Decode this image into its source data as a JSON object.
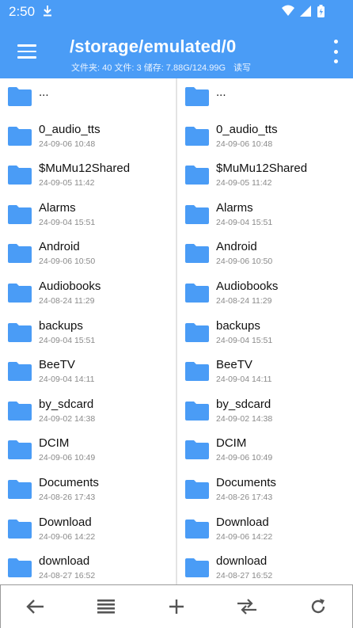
{
  "status_bar": {
    "time": "2:50",
    "icons": [
      "download-icon",
      "wifi-icon",
      "signal-icon",
      "battery-charging-icon"
    ]
  },
  "app_bar": {
    "path": "/storage/emulated/0",
    "info": "文件夹: 40 文件: 3 储存: 7.88G/124.99G",
    "access": "读写",
    "color": "#4a9cf6"
  },
  "up_entry": {
    "name": "..."
  },
  "files": [
    {
      "name": "0_audio_tts",
      "date": "24-09-06 10:48"
    },
    {
      "name": "$MuMu12Shared",
      "date": "24-09-05 11:42"
    },
    {
      "name": "Alarms",
      "date": "24-09-04 15:51"
    },
    {
      "name": "Android",
      "date": "24-09-06 10:50"
    },
    {
      "name": "Audiobooks",
      "date": "24-08-24 11:29"
    },
    {
      "name": "backups",
      "date": "24-09-04 15:51"
    },
    {
      "name": "BeeTV",
      "date": "24-09-04 14:11"
    },
    {
      "name": "by_sdcard",
      "date": "24-09-02 14:38"
    },
    {
      "name": "DCIM",
      "date": "24-09-06 10:49"
    },
    {
      "name": "Documents",
      "date": "24-08-26 17:43"
    },
    {
      "name": "Download",
      "date": "24-09-06 14:22"
    },
    {
      "name": "download",
      "date": "24-08-27 16:52"
    }
  ],
  "toolbar": [
    "back-arrow-icon",
    "list-view-icon",
    "add-icon",
    "swap-panes-icon",
    "refresh-icon"
  ]
}
